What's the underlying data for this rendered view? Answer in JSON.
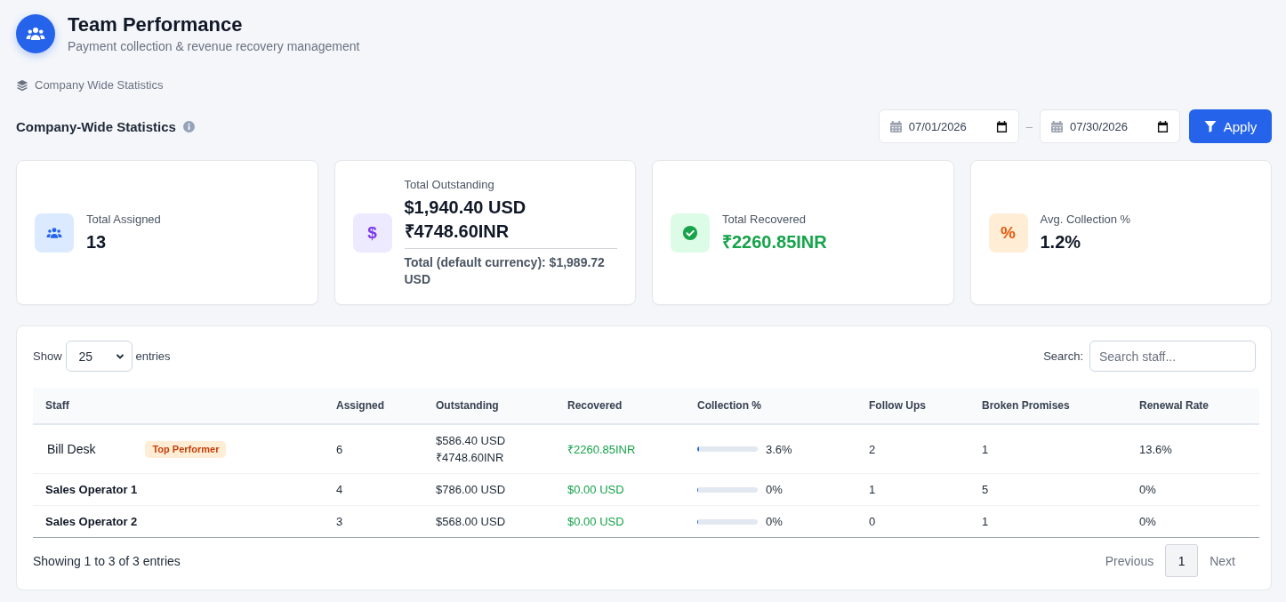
{
  "header": {
    "title": "Team Performance",
    "subtitle": "Payment collection & revenue recovery management"
  },
  "breadcrumb": {
    "label": "Company Wide Statistics"
  },
  "section": {
    "title": "Company-Wide Statistics",
    "date_from": "07/01/2026",
    "date_separator": "–",
    "date_to": "07/30/2026",
    "apply_button": "Apply"
  },
  "cards": [
    {
      "kind": "count",
      "label": "Total Assigned",
      "values": [
        "13"
      ]
    },
    {
      "kind": "outstanding",
      "label": "Total Outstanding",
      "values": [
        "$1,940.40 USD",
        "₹4748.60INR"
      ],
      "note": "Total (default currency): $1,989.72 USD",
      "glyph": "$"
    },
    {
      "kind": "recovered",
      "label": "Total Recovered",
      "values": [
        "₹2260.85INR"
      ]
    },
    {
      "kind": "rate",
      "label": "Avg. Collection %",
      "values": [
        "1.2%"
      ],
      "glyph": "%"
    }
  ],
  "table_controls": {
    "show_label": "Show",
    "page_size": "25",
    "entries_label": "entries",
    "search_label": "Search:",
    "search_placeholder": "Search staff..."
  },
  "table": {
    "columns": [
      "Staff",
      "Assigned",
      "Outstanding",
      "Recovered",
      "Collection %",
      "Follow Ups",
      "Broken Promises",
      "Renewal Rate"
    ],
    "rows": [
      {
        "staff": "Bill Desk",
        "bold": false,
        "badge": "Top Performer",
        "assigned": "6",
        "outstanding": [
          "$586.40 USD",
          "₹4748.60INR"
        ],
        "recovered": "₹2260.85INR",
        "collection": {
          "level": 0.036,
          "reading": "3.6%"
        },
        "follow_ups": "2",
        "broken_promises": "1",
        "renewal_rate": "13.6%"
      },
      {
        "staff": "Sales Operator 1",
        "bold": true,
        "assigned": "4",
        "outstanding": [
          "$786.00 USD"
        ],
        "recovered": "$0.00 USD",
        "collection": {
          "level": 0,
          "reading": "0%"
        },
        "follow_ups": "1",
        "broken_promises": "5",
        "renewal_rate": "0%"
      },
      {
        "staff": "Sales Operator 2",
        "bold": true,
        "assigned": "3",
        "outstanding": [
          "$568.00 USD"
        ],
        "recovered": "$0.00 USD",
        "collection": {
          "level": 0,
          "reading": "0%"
        },
        "follow_ups": "0",
        "broken_promises": "1",
        "renewal_rate": "0%"
      }
    ]
  },
  "footer": {
    "summary": "Showing 1 to 3 of 3 entries",
    "pages": [
      {
        "label": "Previous",
        "kind": "nav",
        "selected": false
      },
      {
        "label": "1",
        "kind": "page",
        "selected": true
      },
      {
        "label": "Next",
        "kind": "nav",
        "selected": false
      }
    ]
  }
}
